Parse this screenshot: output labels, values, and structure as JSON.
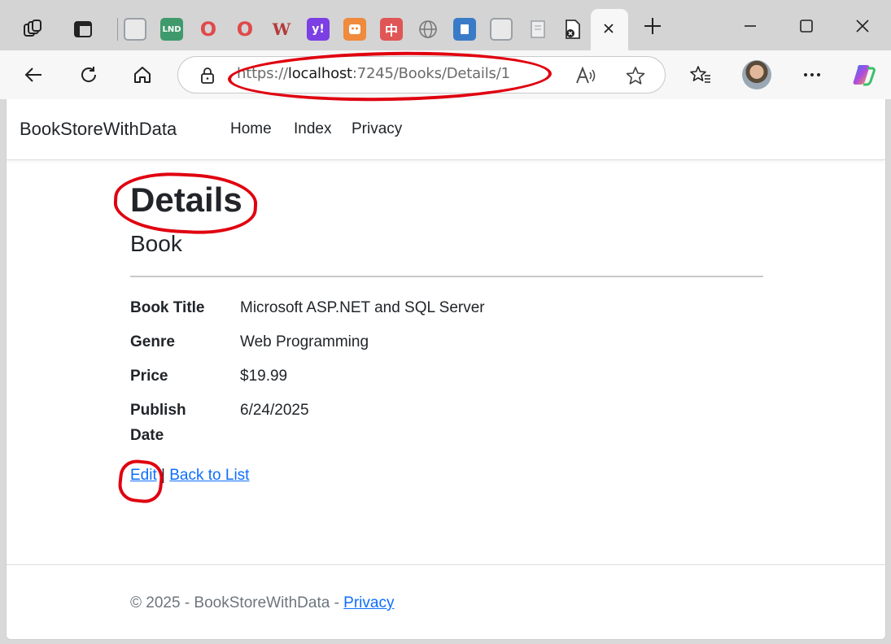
{
  "browser": {
    "tabs": [
      {
        "icon": "workspaces-icon"
      },
      {
        "icon": "tab-actions-icon"
      },
      {
        "icon": "site-favicon",
        "color": "#9aa0a6"
      },
      {
        "icon": "lnd-favicon",
        "text": "LND",
        "color": "#3f9a6b"
      },
      {
        "icon": "opera-favicon",
        "text": "O",
        "color": "#e04a4a"
      },
      {
        "icon": "opera-favicon",
        "text": "O",
        "color": "#e04a4a"
      },
      {
        "icon": "w-favicon",
        "text": "W",
        "color": "#b33a3a"
      },
      {
        "icon": "yahoo-favicon",
        "text": "y!",
        "color": "#7b3fe4"
      },
      {
        "icon": "robot-favicon",
        "color": "#f08a3c"
      },
      {
        "icon": "zhong-favicon",
        "text": "中",
        "color": "#e05555"
      },
      {
        "icon": "globe-favicon",
        "color": "#777777"
      },
      {
        "icon": "doc-favicon",
        "color": "#3a7bc8"
      },
      {
        "icon": "site-favicon",
        "color": "#9aa0a6"
      },
      {
        "icon": "file-favicon",
        "color": "#9aa0a6"
      },
      {
        "icon": "error-file-favicon",
        "color": "#333333"
      }
    ],
    "url": {
      "scheme": "https://",
      "host": "localhost",
      "rest": ":7245/Books/Details/1"
    }
  },
  "navbar": {
    "brand": "BookStoreWithData",
    "links": [
      "Home",
      "Index",
      "Privacy"
    ]
  },
  "main": {
    "title": "Details",
    "subtitle": "Book",
    "fields": [
      {
        "label": "Book Title",
        "value": "Microsoft ASP.NET and SQL Server"
      },
      {
        "label": "Genre",
        "value": "Web Programming"
      },
      {
        "label": "Price",
        "value": "$19.99"
      },
      {
        "label": "Publish Date",
        "value": "6/24/2025"
      }
    ],
    "edit_link": "Edit",
    "separator": "|",
    "back_link": "Back to List"
  },
  "footer": {
    "text": "© 2025 - BookStoreWithData - ",
    "privacy_link": "Privacy"
  },
  "colors": {
    "link": "#0d6efd",
    "annotation": "#e0000f"
  }
}
